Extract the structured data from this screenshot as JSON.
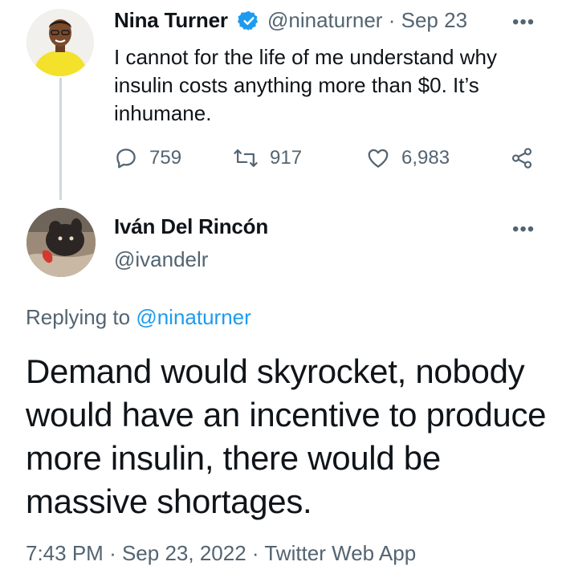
{
  "tweet1": {
    "name": "Nina Turner",
    "handle": "@ninaturner",
    "separator": "·",
    "date": "Sep 23",
    "text": "I cannot for the life of me understand why insulin costs anything more than $0. It’s inhumane.",
    "replies": "759",
    "retweets": "917",
    "likes": "6,983"
  },
  "tweet2": {
    "name": "Iván Del Rincón",
    "handle": "@ivandelr",
    "replying_prefix": "Replying to",
    "replying_to": "@ninaturner",
    "text": "Demand would skyrocket, nobody would have an incentive to produce more insulin, there would be massive shortages.",
    "time": "7:43 PM",
    "date": "Sep 23, 2022",
    "source": "Twitter Web App",
    "meta_separator": "·"
  },
  "icons": {
    "verified": "verified-badge-icon",
    "more": "more-icon",
    "reply": "reply-icon",
    "retweet": "retweet-icon",
    "like": "like-icon",
    "share": "share-icon"
  },
  "colors": {
    "accent": "#1d9bf0",
    "muted": "#536471",
    "text": "#0f1419",
    "thread_line": "#cfd9de"
  }
}
